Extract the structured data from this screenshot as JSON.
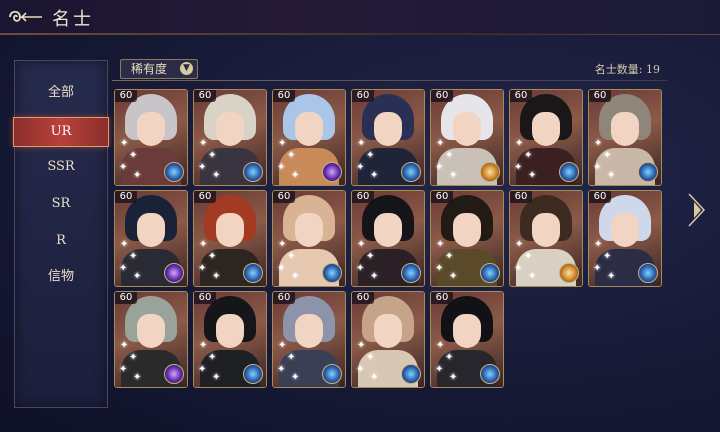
{
  "header": {
    "title": "名士"
  },
  "sidebar": {
    "items": [
      {
        "label": "全部",
        "active": false
      },
      {
        "label": "UR",
        "active": true
      },
      {
        "label": "SSR",
        "active": false
      },
      {
        "label": "SR",
        "active": false
      },
      {
        "label": "R",
        "active": false
      },
      {
        "label": "信物",
        "active": false
      }
    ]
  },
  "toolbar": {
    "filter_label": "稀有度",
    "count_text": "名士数量: 19"
  },
  "cards": [
    {
      "level": "60",
      "hair": "#c9c4c8",
      "body": "#6b3a3a",
      "emblem": "blue"
    },
    {
      "level": "60",
      "hair": "#d9d2c7",
      "body": "#3a3440",
      "emblem": "blue"
    },
    {
      "level": "60",
      "hair": "#a9c6e8",
      "body": "#c98a5a",
      "emblem": "purple"
    },
    {
      "level": "60",
      "hair": "#2a2f55",
      "body": "#1f2438",
      "emblem": "blue"
    },
    {
      "level": "60",
      "hair": "#e6e6ea",
      "body": "#c9c1b8",
      "emblem": "gold"
    },
    {
      "level": "60",
      "hair": "#1b1618",
      "body": "#3a2020",
      "emblem": "blue"
    },
    {
      "level": "60",
      "hair": "#8f8579",
      "body": "#c9b8a8",
      "emblem": "blue"
    },
    {
      "level": "60",
      "hair": "#1a2238",
      "body": "#2a2a35",
      "emblem": "purple"
    },
    {
      "level": "60",
      "hair": "#a33b22",
      "body": "#2d2520",
      "emblem": "blue"
    },
    {
      "level": "60",
      "hair": "#d8b495",
      "body": "#e6c7b0",
      "emblem": "blue"
    },
    {
      "level": "60",
      "hair": "#151418",
      "body": "#2a2025",
      "emblem": "blue"
    },
    {
      "level": "60",
      "hair": "#221a14",
      "body": "#5a4a2a",
      "emblem": "blue"
    },
    {
      "level": "60",
      "hair": "#3d2b22",
      "body": "#d9cfc2",
      "emblem": "gold"
    },
    {
      "level": "60",
      "hair": "#cfd8ea",
      "body": "#2a2d45",
      "emblem": "blue"
    },
    {
      "level": "60",
      "hair": "#9aa39a",
      "body": "#2a2a2a",
      "emblem": "purple"
    },
    {
      "level": "60",
      "hair": "#14161a",
      "body": "#1e2024",
      "emblem": "blue"
    },
    {
      "level": "60",
      "hair": "#8d93a8",
      "body": "#3a3f55",
      "emblem": "blue"
    },
    {
      "level": "60",
      "hair": "#c5a48a",
      "body": "#d9c7b5",
      "emblem": "blue"
    },
    {
      "level": "60",
      "hair": "#121216",
      "body": "#26262c",
      "emblem": "blue"
    }
  ]
}
